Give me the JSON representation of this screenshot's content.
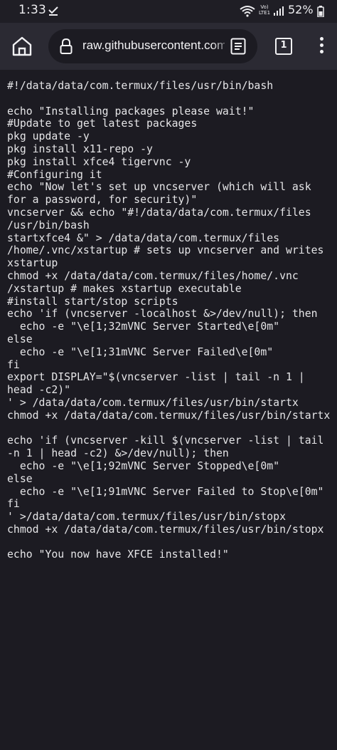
{
  "status_bar": {
    "time": "1:33",
    "network_label": "Vo) LTE1",
    "battery_percent": "52%"
  },
  "toolbar": {
    "url": "raw.githubusercontent.com",
    "tab_count": "1"
  },
  "file_lines": [
    "#!/data/data/com.termux/files/usr/bin/bash",
    "",
    "echo \"Installing packages please wait!\"",
    "#Update to get latest packages",
    "pkg update -y",
    "pkg install x11-repo -y",
    "pkg install xfce4 tigervnc -y",
    "#Configuring it",
    "echo \"Now let's set up vncserver (which will ask",
    "for a password, for security)\"",
    "vncserver && echo \"#!/data/data/com.termux/files",
    "/usr/bin/bash",
    "startxfce4 &\" > /data/data/com.termux/files",
    "/home/.vnc/xstartup # sets up vncserver and writes",
    "xstartup",
    "chmod +x /data/data/com.termux/files/home/.vnc",
    "/xstartup # makes xstartup executable",
    "#install start/stop scripts",
    "echo 'if (vncserver -localhost &>/dev/null); then",
    "  echo -e \"\\e[1;32mVNC Server Started\\e[0m\"",
    "else",
    "  echo -e \"\\e[1;31mVNC Server Failed\\e[0m\"",
    "fi",
    "export DISPLAY=\"$(vncserver -list | tail -n 1 |",
    "head -c2)\"",
    "' > /data/data/com.termux/files/usr/bin/startx",
    "chmod +x /data/data/com.termux/files/usr/bin/startx",
    "",
    "echo 'if (vncserver -kill $(vncserver -list | tail",
    "-n 1 | head -c2) &>/dev/null); then",
    "  echo -e \"\\e[1;92mVNC Server Stopped\\e[0m\"",
    "else",
    "  echo -e \"\\e[1;91mVNC Server Failed to Stop\\e[0m\"",
    "fi",
    "' >/data/data/com.termux/files/usr/bin/stopx",
    "chmod +x /data/data/com.termux/files/usr/bin/stopx",
    "",
    "echo \"You now have XFCE installed!\""
  ],
  "icons": {
    "status_check": "check-icon",
    "wifi": "wifi-icon",
    "signal": "signal-icon",
    "battery": "battery-icon",
    "home": "home-icon",
    "lock": "lock-icon",
    "reader": "reader-mode-icon",
    "tabs": "tabs-icon",
    "menu": "overflow-menu-icon"
  },
  "colors": {
    "page_background": "#1c1b22",
    "toolbar_background": "#2b2a33",
    "text": "#e6e6e8"
  }
}
